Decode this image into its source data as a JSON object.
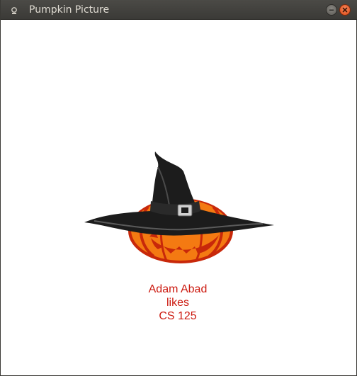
{
  "window": {
    "title": "Pumpkin Picture"
  },
  "icons": {
    "app": "app-icon",
    "minimize": "minimize-icon",
    "close": "close-icon",
    "picture": "jack-o-lantern-witch-hat"
  },
  "caption": {
    "lines": [
      "Adam Abad",
      "likes",
      "CS 125"
    ],
    "color": "#cc1a10"
  },
  "colors": {
    "pumpkin": "#f47a12",
    "pumpkin_dark": "#c8280a",
    "hat": "#1c1c1c",
    "titlebar": "#3c3b37"
  }
}
